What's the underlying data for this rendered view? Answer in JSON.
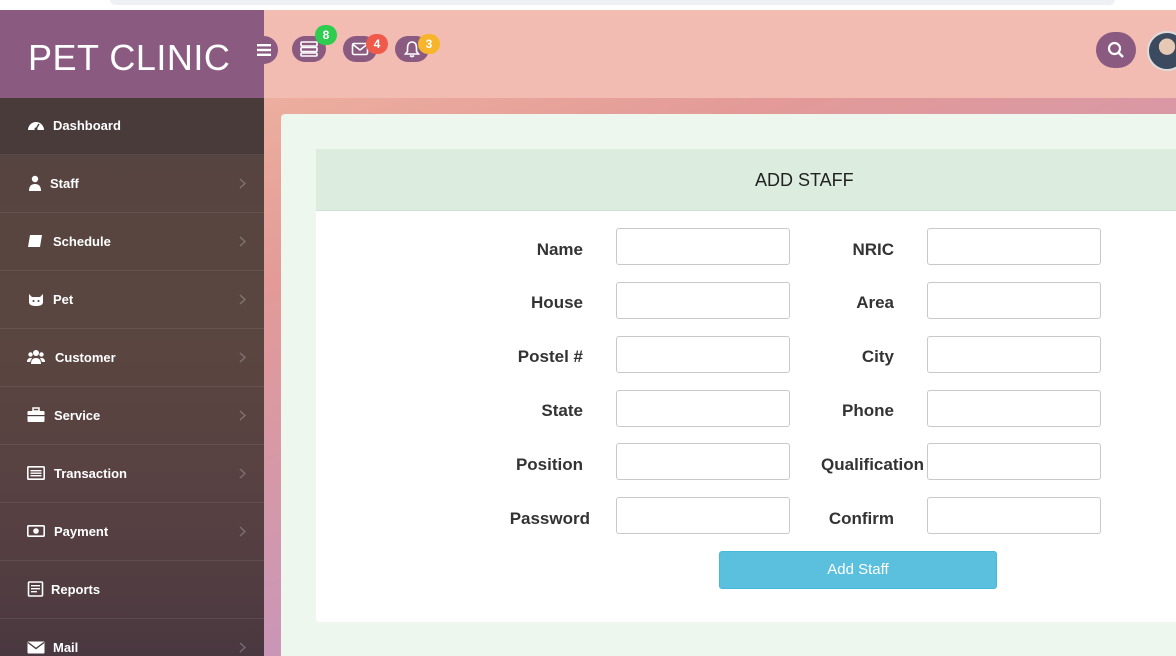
{
  "app": {
    "title": "PET CLINIC"
  },
  "topbar": {
    "badges": {
      "tasks": "8",
      "messages": "4",
      "notifications": "3"
    },
    "badge_colors": {
      "tasks": "#2ecc4f",
      "messages": "#f05a4a",
      "notifications": "#f7b52c"
    }
  },
  "sidebar": {
    "items": [
      {
        "label": "Dashboard",
        "icon": "dashboard-icon"
      },
      {
        "label": "Staff",
        "icon": "staff-icon"
      },
      {
        "label": "Schedule",
        "icon": "book-icon"
      },
      {
        "label": "Pet",
        "icon": "cat-icon"
      },
      {
        "label": "Customer",
        "icon": "users-icon"
      },
      {
        "label": "Service",
        "icon": "briefcase-icon"
      },
      {
        "label": "Transaction",
        "icon": "list-icon"
      },
      {
        "label": "Payment",
        "icon": "money-icon"
      },
      {
        "label": "Reports",
        "icon": "report-icon"
      },
      {
        "label": "Mail",
        "icon": "mail-icon"
      }
    ]
  },
  "form": {
    "heading": "ADD STAFF",
    "left_labels": [
      "Name",
      "House",
      "Postel #",
      "State",
      "Position",
      "Password"
    ],
    "right_labels": [
      "NRIC",
      "Area",
      "City",
      "Phone",
      "Qualification",
      "Confirm"
    ],
    "submit_label": "Add Staff"
  }
}
